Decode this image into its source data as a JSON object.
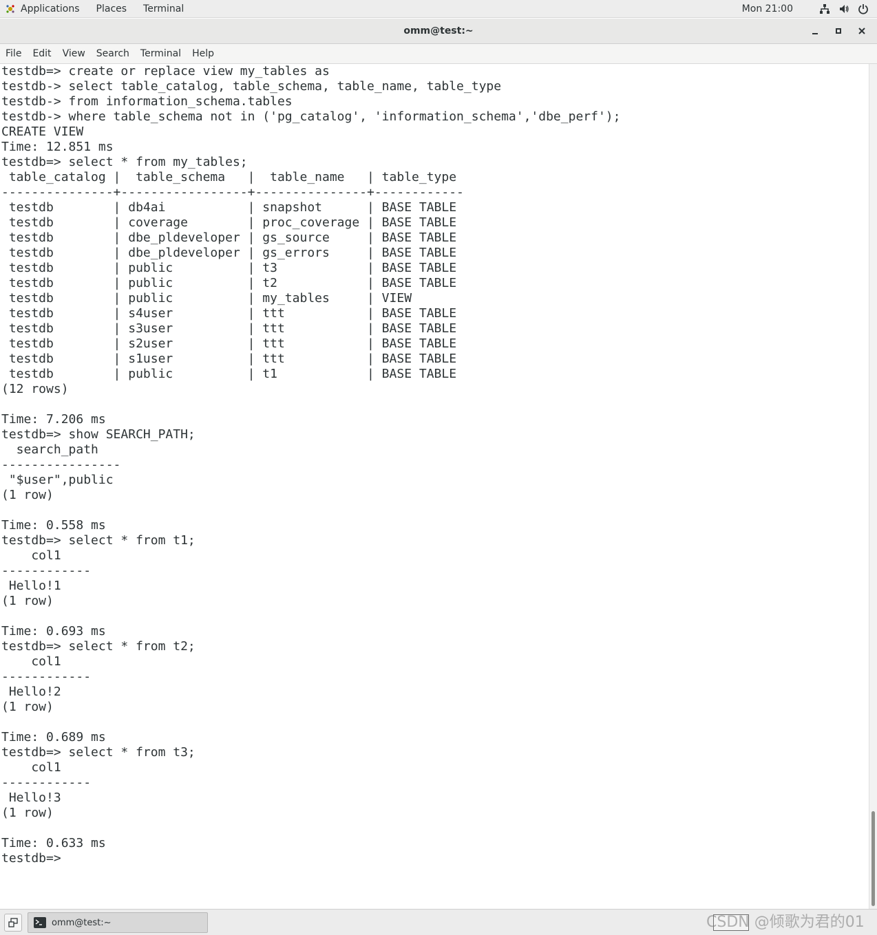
{
  "top_panel": {
    "applications": "Applications",
    "places": "Places",
    "terminal": "Terminal",
    "clock": "Mon 21:00"
  },
  "window": {
    "title": "omm@test:~"
  },
  "menu": [
    "File",
    "Edit",
    "View",
    "Search",
    "Terminal",
    "Help"
  ],
  "terminal_lines": [
    "testdb=> create or replace view my_tables as",
    "testdb-> select table_catalog, table_schema, table_name, table_type",
    "testdb-> from information_schema.tables",
    "testdb-> where table_schema not in ('pg_catalog', 'information_schema','dbe_perf');",
    "CREATE VIEW",
    "Time: 12.851 ms",
    "testdb=> select * from my_tables;",
    " table_catalog |  table_schema   |  table_name   | table_type",
    "---------------+-----------------+---------------+------------",
    " testdb        | db4ai           | snapshot      | BASE TABLE",
    " testdb        | coverage        | proc_coverage | BASE TABLE",
    " testdb        | dbe_pldeveloper | gs_source     | BASE TABLE",
    " testdb        | dbe_pldeveloper | gs_errors     | BASE TABLE",
    " testdb        | public          | t3            | BASE TABLE",
    " testdb        | public          | t2            | BASE TABLE",
    " testdb        | public          | my_tables     | VIEW",
    " testdb        | s4user          | ttt           | BASE TABLE",
    " testdb        | s3user          | ttt           | BASE TABLE",
    " testdb        | s2user          | ttt           | BASE TABLE",
    " testdb        | s1user          | ttt           | BASE TABLE",
    " testdb        | public          | t1            | BASE TABLE",
    "(12 rows)",
    "",
    "Time: 7.206 ms",
    "testdb=> show SEARCH_PATH;",
    "  search_path",
    "----------------",
    " \"$user\",public",
    "(1 row)",
    "",
    "Time: 0.558 ms",
    "testdb=> select * from t1;",
    "    col1",
    "------------",
    " Hello!1",
    "(1 row)",
    "",
    "Time: 0.693 ms",
    "testdb=> select * from t2;",
    "    col1",
    "------------",
    " Hello!2",
    "(1 row)",
    "",
    "Time: 0.689 ms",
    "testdb=> select * from t3;",
    "    col1",
    "------------",
    " Hello!3",
    "(1 row)",
    "",
    "Time: 0.633 ms",
    "testdb=> "
  ],
  "taskbar": {
    "task_label": "omm@test:~",
    "watermark": "CSDN @倾歌为君的01"
  }
}
